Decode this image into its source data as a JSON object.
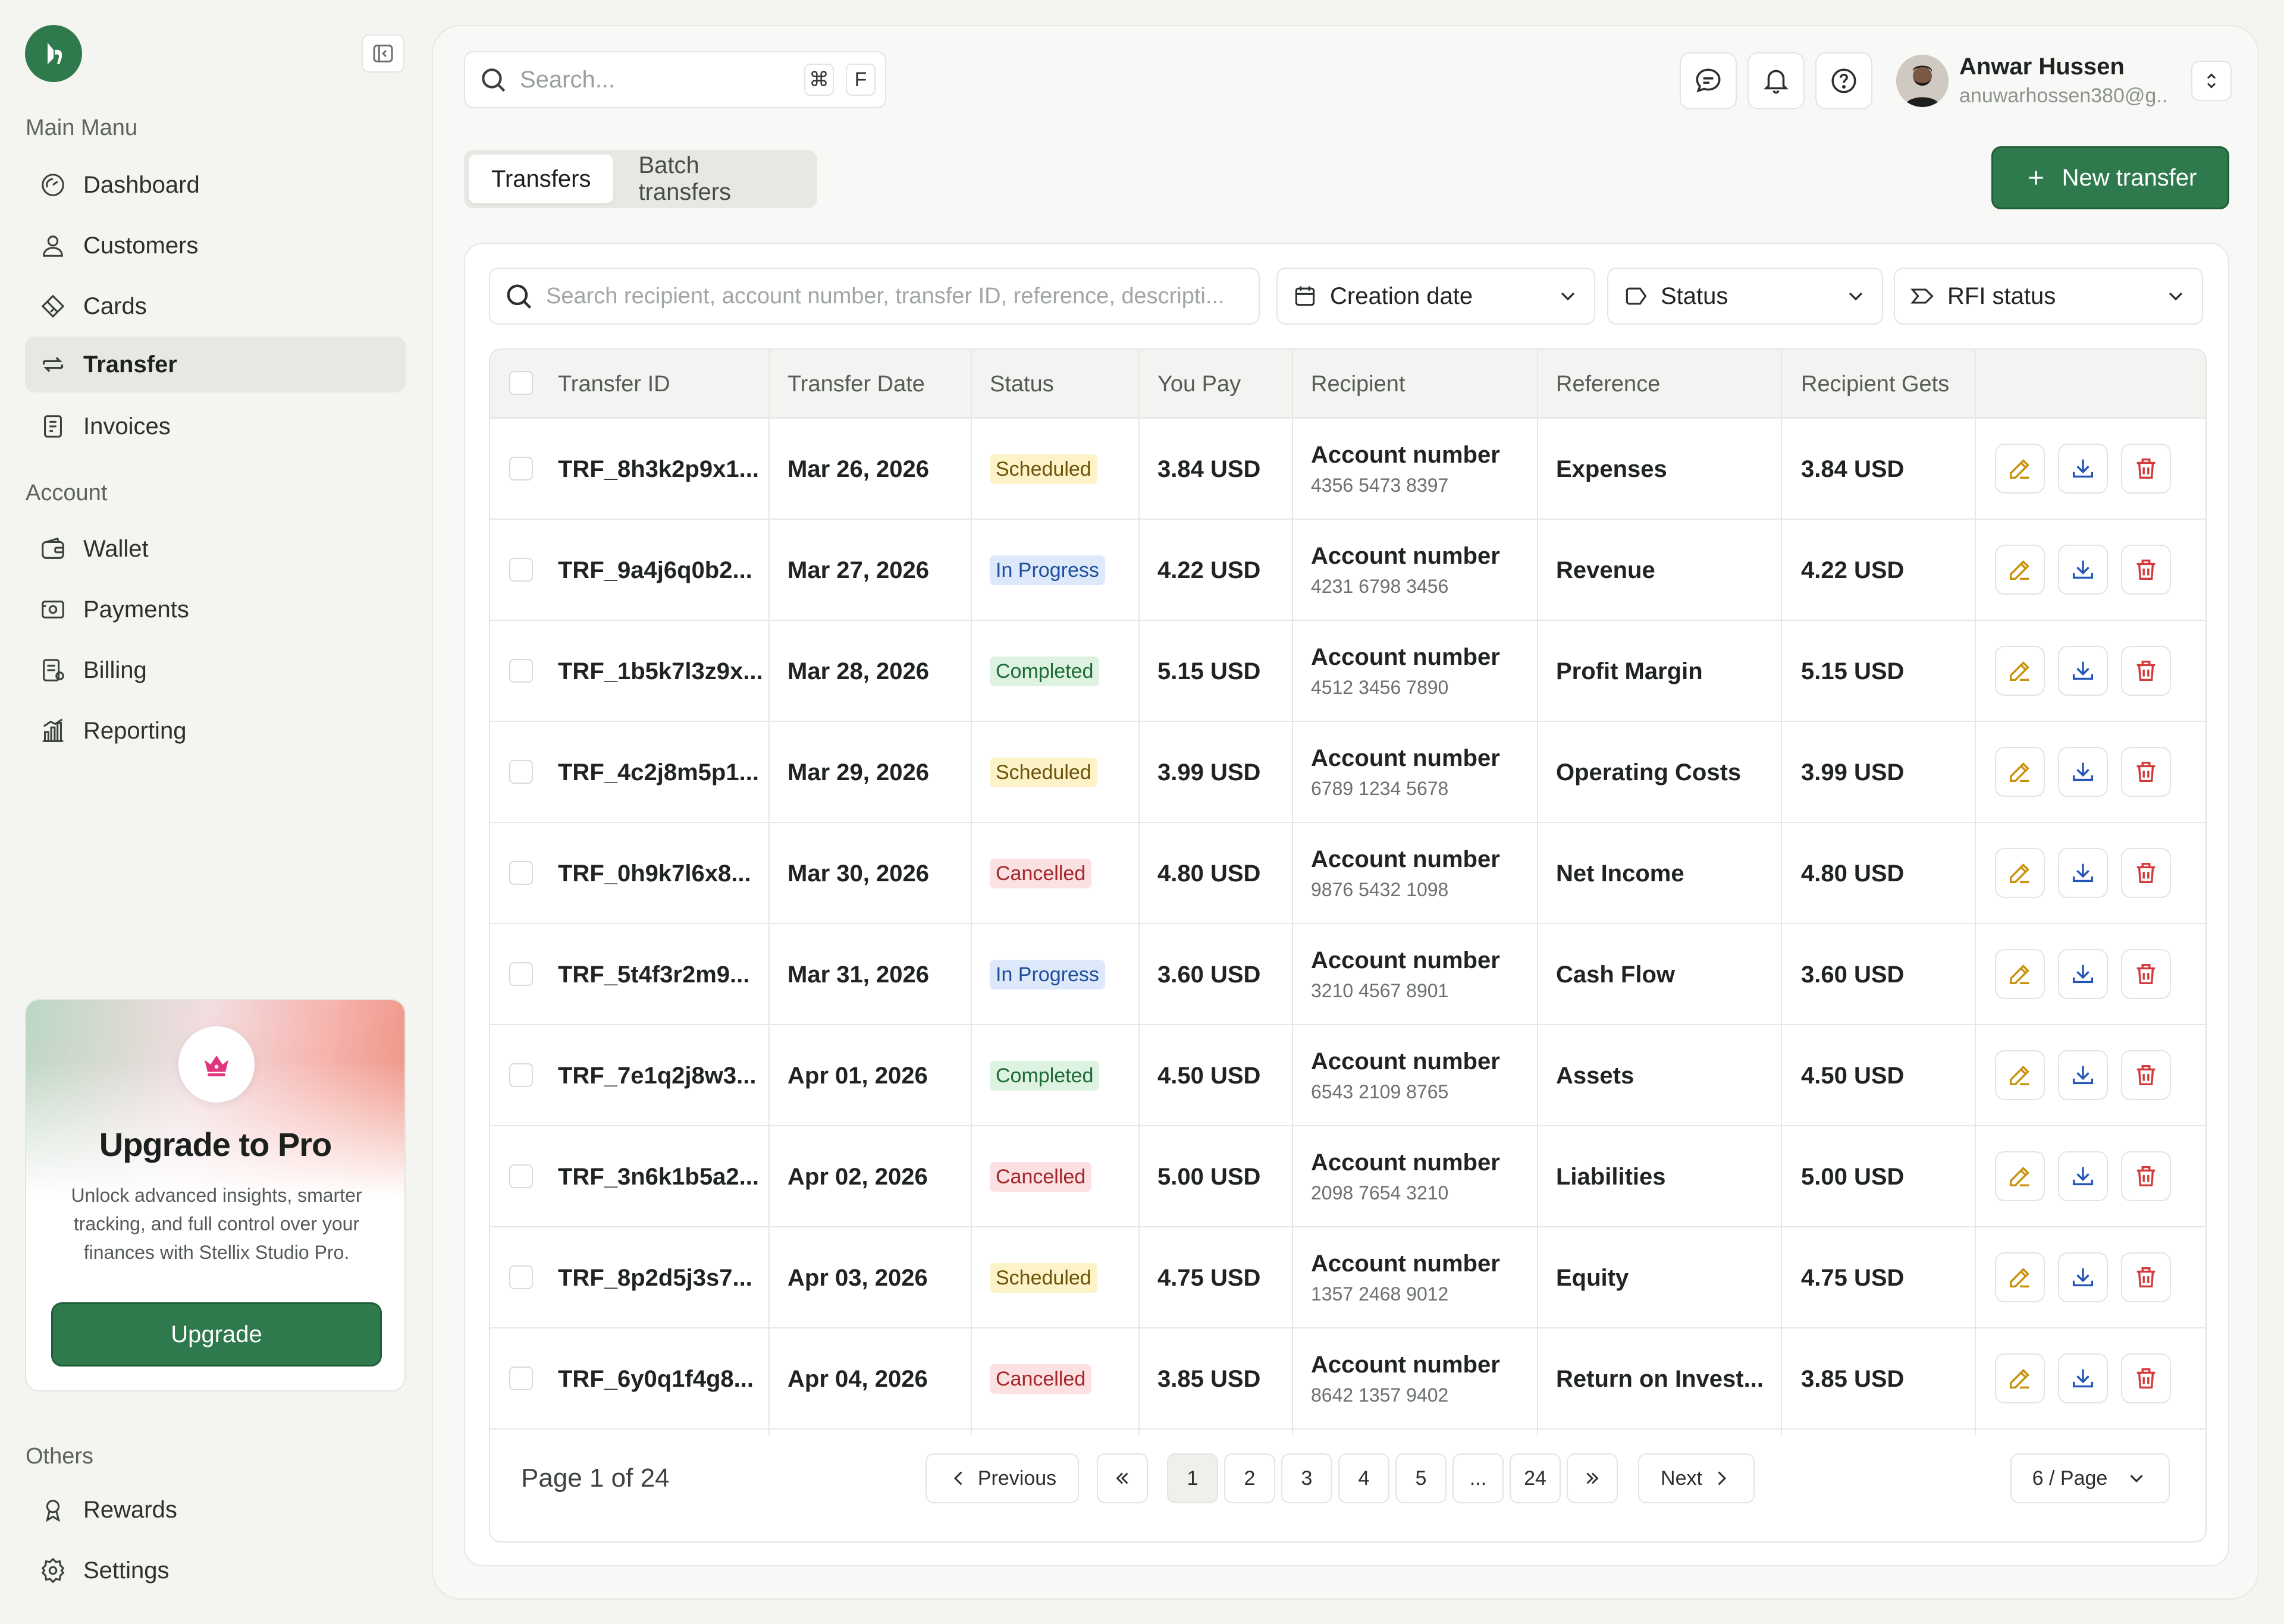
{
  "sidebar": {
    "sections": {
      "main": "Main Manu",
      "account": "Account",
      "others": "Others"
    },
    "main_items": [
      {
        "label": "Dashboard",
        "icon": "gauge-icon"
      },
      {
        "label": "Customers",
        "icon": "user-icon"
      },
      {
        "label": "Cards",
        "icon": "card-icon"
      },
      {
        "label": "Transfer",
        "icon": "transfer-icon",
        "active": true
      },
      {
        "label": "Invoices",
        "icon": "invoice-icon"
      }
    ],
    "account_items": [
      {
        "label": "Wallet",
        "icon": "wallet-icon"
      },
      {
        "label": "Payments",
        "icon": "payments-icon"
      },
      {
        "label": "Billing",
        "icon": "billing-icon"
      },
      {
        "label": "Reporting",
        "icon": "reporting-icon"
      }
    ],
    "other_items": [
      {
        "label": "Rewards",
        "icon": "rewards-icon"
      },
      {
        "label": "Settings",
        "icon": "settings-icon"
      }
    ],
    "promo": {
      "title": "Upgrade to Pro",
      "description": "Unlock advanced insights, smarter tracking, and full control over your finances with Stellix Studio Pro.",
      "button": "Upgrade"
    }
  },
  "header": {
    "search_placeholder": "Search...",
    "shortcut_mod": "⌘",
    "shortcut_key": "F",
    "user": {
      "name": "Anwar Hussen",
      "email": "anuwarhossen380@g.."
    }
  },
  "tabs": [
    "Transfers",
    "Batch transfers"
  ],
  "new_transfer_label": "New transfer",
  "filters": {
    "search_placeholder": "Search recipient, account number, transfer ID, reference, descripti...",
    "creation_date": "Creation date",
    "status": "Status",
    "rfi_status": "RFI status"
  },
  "table": {
    "columns": [
      "Transfer ID",
      "Transfer Date",
      "Status",
      "You Pay",
      "Recipient",
      "Reference",
      "Recipient Gets"
    ],
    "rows": [
      {
        "id": "TRF_8h3k2p9x1...",
        "date": "Mar 26, 2026",
        "status": "Scheduled",
        "pay": "3.84 USD",
        "recipient": "Account number",
        "account": "4356 5473 8397",
        "reference": "Expenses",
        "gets": "3.84 USD"
      },
      {
        "id": "TRF_9a4j6q0b2...",
        "date": "Mar 27, 2026",
        "status": "In Progress",
        "pay": "4.22 USD",
        "recipient": "Account number",
        "account": "4231 6798 3456",
        "reference": "Revenue",
        "gets": "4.22 USD"
      },
      {
        "id": "TRF_1b5k7l3z9x...",
        "date": "Mar 28, 2026",
        "status": "Completed",
        "pay": "5.15 USD",
        "recipient": "Account number",
        "account": "4512 3456 7890",
        "reference": "Profit Margin",
        "gets": "5.15 USD"
      },
      {
        "id": "TRF_4c2j8m5p1...",
        "date": "Mar 29, 2026",
        "status": "Scheduled",
        "pay": "3.99 USD",
        "recipient": "Account number",
        "account": "6789 1234 5678",
        "reference": "Operating Costs",
        "gets": "3.99 USD"
      },
      {
        "id": "TRF_0h9k7l6x8...",
        "date": "Mar 30, 2026",
        "status": "Cancelled",
        "pay": "4.80 USD",
        "recipient": "Account number",
        "account": "9876 5432 1098",
        "reference": "Net Income",
        "gets": "4.80 USD"
      },
      {
        "id": "TRF_5t4f3r2m9...",
        "date": "Mar 31, 2026",
        "status": "In Progress",
        "pay": "3.60 USD",
        "recipient": "Account number",
        "account": "3210 4567 8901",
        "reference": "Cash Flow",
        "gets": "3.60 USD"
      },
      {
        "id": "TRF_7e1q2j8w3...",
        "date": "Apr 01, 2026",
        "status": "Completed",
        "pay": "4.50 USD",
        "recipient": "Account number",
        "account": "6543 2109 8765",
        "reference": "Assets",
        "gets": "4.50 USD"
      },
      {
        "id": "TRF_3n6k1b5a2...",
        "date": "Apr 02, 2026",
        "status": "Cancelled",
        "pay": "5.00 USD",
        "recipient": "Account number",
        "account": "2098 7654 3210",
        "reference": "Liabilities",
        "gets": "5.00 USD"
      },
      {
        "id": "TRF_8p2d5j3s7...",
        "date": "Apr 03, 2026",
        "status": "Scheduled",
        "pay": "4.75 USD",
        "recipient": "Account number",
        "account": "1357 2468 9012",
        "reference": "Equity",
        "gets": "4.75 USD"
      },
      {
        "id": "TRF_6y0q1f4g8...",
        "date": "Apr 04, 2026",
        "status": "Cancelled",
        "pay": "3.85 USD",
        "recipient": "Account number",
        "account": "8642 1357 9402",
        "reference": "Return on Invest...",
        "gets": "3.85 USD"
      }
    ]
  },
  "pagination": {
    "info": "Page 1 of 24",
    "previous": "Previous",
    "next": "Next",
    "pages": [
      "1",
      "2",
      "3",
      "4",
      "5",
      "...",
      "24"
    ],
    "current": "1",
    "per_page": "6 / Page"
  },
  "colors": {
    "brand_green": "#2f7a4c",
    "edit_icon": "#c9920e",
    "download_icon": "#2456b8",
    "delete_icon": "#d23b3b"
  }
}
